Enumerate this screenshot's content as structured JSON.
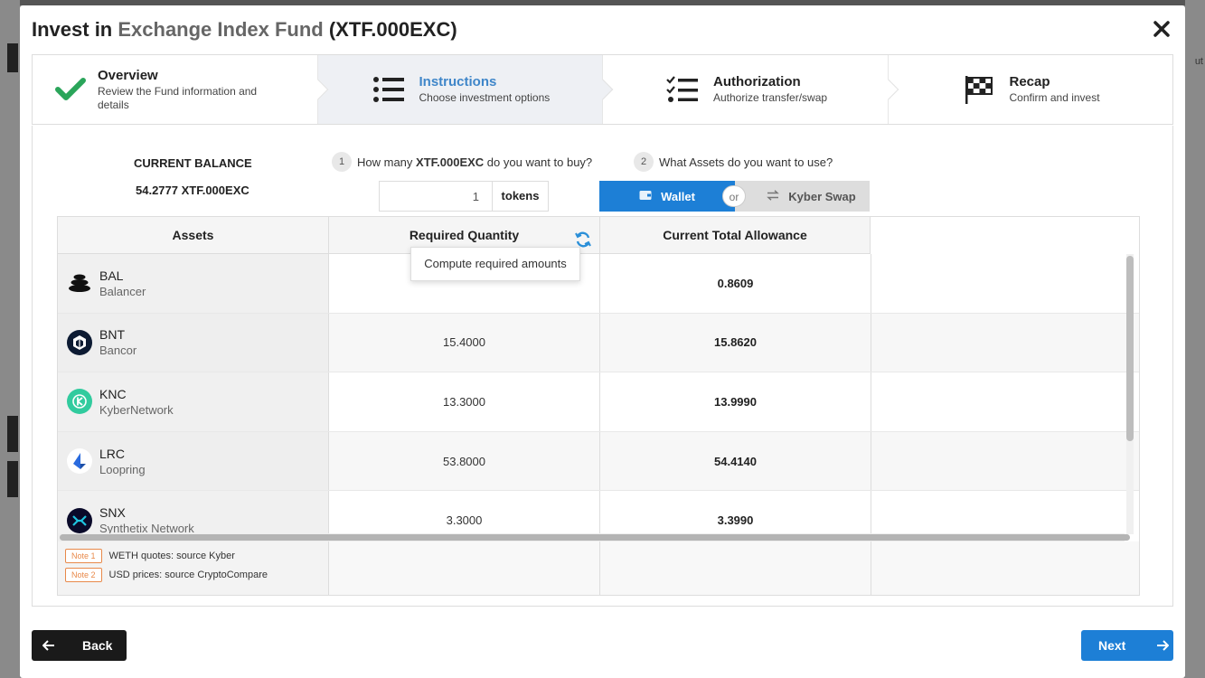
{
  "modal": {
    "title_prefix": "Invest in ",
    "fund_name": "Exchange Index Fund",
    "fund_ticker": " (XTF.000EXC)",
    "close_label": "✕"
  },
  "steps": [
    {
      "title": "Overview",
      "subtitle": "Review the Fund information and details",
      "icon": "checkmark-icon"
    },
    {
      "title": "Instructions",
      "subtitle": "Choose investment options",
      "icon": "list-icon"
    },
    {
      "title": "Authorization",
      "subtitle": "Authorize transfer/swap",
      "icon": "checklist-icon"
    },
    {
      "title": "Recap",
      "subtitle": "Confirm and invest",
      "icon": "checkered-flag-icon"
    }
  ],
  "balance": {
    "label": "CURRENT BALANCE",
    "value": "54.2777 XTF.000EXC"
  },
  "question1": {
    "number": "1",
    "text_before": "How many ",
    "ticker": "XTF.000EXC",
    "text_after": " do you want to buy?"
  },
  "question2": {
    "number": "2",
    "text": "What Assets do you want to use?"
  },
  "quantity": {
    "value": "1",
    "unit": "tokens"
  },
  "source_toggle": {
    "wallet": "Wallet",
    "or": "or",
    "kyber": "Kyber Swap"
  },
  "table": {
    "headers": [
      "Assets",
      "Required Quantity",
      "Current Total Allowance"
    ],
    "rows": [
      {
        "symbol": "BAL",
        "name": "Balancer",
        "required": "",
        "allowance": "0.8609",
        "icon": "balancer-icon"
      },
      {
        "symbol": "BNT",
        "name": "Bancor",
        "required": "15.4000",
        "allowance": "15.8620",
        "icon": "bancor-icon"
      },
      {
        "symbol": "KNC",
        "name": "KyberNetwork",
        "required": "13.3000",
        "allowance": "13.9990",
        "icon": "kyber-icon"
      },
      {
        "symbol": "LRC",
        "name": "Loopring",
        "required": "53.8000",
        "allowance": "54.4140",
        "icon": "loopring-icon"
      },
      {
        "symbol": "SNX",
        "name": "Synthetix Network",
        "required": "3.3000",
        "allowance": "3.3990",
        "icon": "synthetix-icon"
      }
    ],
    "notes": [
      {
        "badge": "Note 1",
        "text": "WETH quotes: source Kyber"
      },
      {
        "badge": "Note 2",
        "text": "USD prices: source CryptoCompare"
      }
    ]
  },
  "tooltip": "Compute required amounts",
  "buttons": {
    "back": "Back",
    "next": "Next"
  },
  "background": {
    "right_fragment": "ut"
  }
}
